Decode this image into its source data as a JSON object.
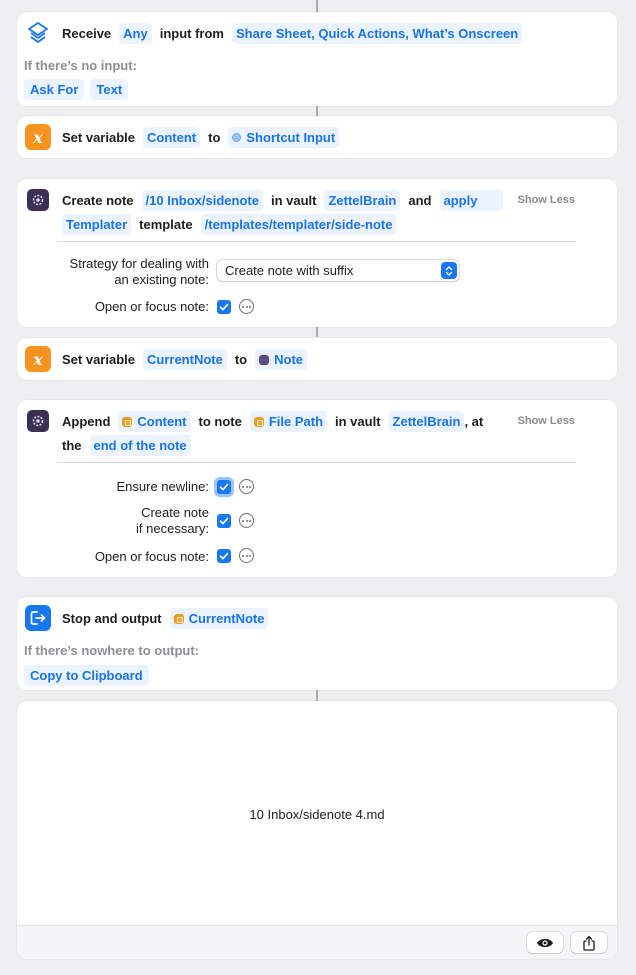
{
  "receive": {
    "label_receive": "Receive",
    "token_any": "Any",
    "label_input_from": "input from",
    "token_sources": "Share Sheet, Quick Actions, What’s Onscreen",
    "no_input_label": "If there’s no input:",
    "ask_for": "Ask For",
    "text": "Text",
    "icon": "shortcuts-layers-icon"
  },
  "set_content": {
    "label_set": "Set variable",
    "variable": "Content",
    "label_to": "to",
    "value": "Shortcut Input",
    "icon": "variable-x-icon"
  },
  "create_note": {
    "label_create": "Create note",
    "path": "/10 Inbox/sidenote",
    "label_in_vault": "in vault",
    "vault": "ZettelBrain",
    "label_and": "and",
    "apply": "apply",
    "show_less": "Show Less",
    "templater": "Templater",
    "label_template": "template",
    "template_path": "/templates/templater/side-note",
    "strategy_label_1": "Strategy for dealing with",
    "strategy_label_2": "an existing note:",
    "strategy_value": "Create note with suffix",
    "open_label": "Open or focus note:",
    "open_checked": true,
    "icon": "obsidian-icon"
  },
  "set_current": {
    "label_set": "Set variable",
    "variable": "CurrentNote",
    "label_to": "to",
    "value": "Note",
    "icon": "variable-x-icon"
  },
  "append": {
    "label_append": "Append",
    "content": "Content",
    "label_to_note": "to note",
    "file_path": "File Path",
    "label_in_vault": "in vault",
    "vault": "ZettelBrain",
    "label_at": ", at",
    "label_the": "the",
    "position": "end of the note",
    "show_less": "Show Less",
    "newline_label": "Ensure newline:",
    "create_label_1": "Create note",
    "create_label_2": "if necessary:",
    "open_label": "Open or focus note:",
    "icon": "obsidian-icon"
  },
  "stop": {
    "label_stop": "Stop and output",
    "value": "CurrentNote",
    "nowhere_label": "If there’s nowhere to output:",
    "copy": "Copy to Clipboard",
    "icon": "stop-output-icon"
  },
  "output": {
    "filename": "10 Inbox/sidenote 4.md",
    "preview_icon": "eye-icon",
    "share_icon": "share-icon"
  },
  "colors": {
    "accent": "#1877f2",
    "token_bg": "#eaf3ff",
    "token_text": "#1a73e8",
    "variable_orange": "#f7921e",
    "obsidian_purple": "#3b2f52"
  }
}
